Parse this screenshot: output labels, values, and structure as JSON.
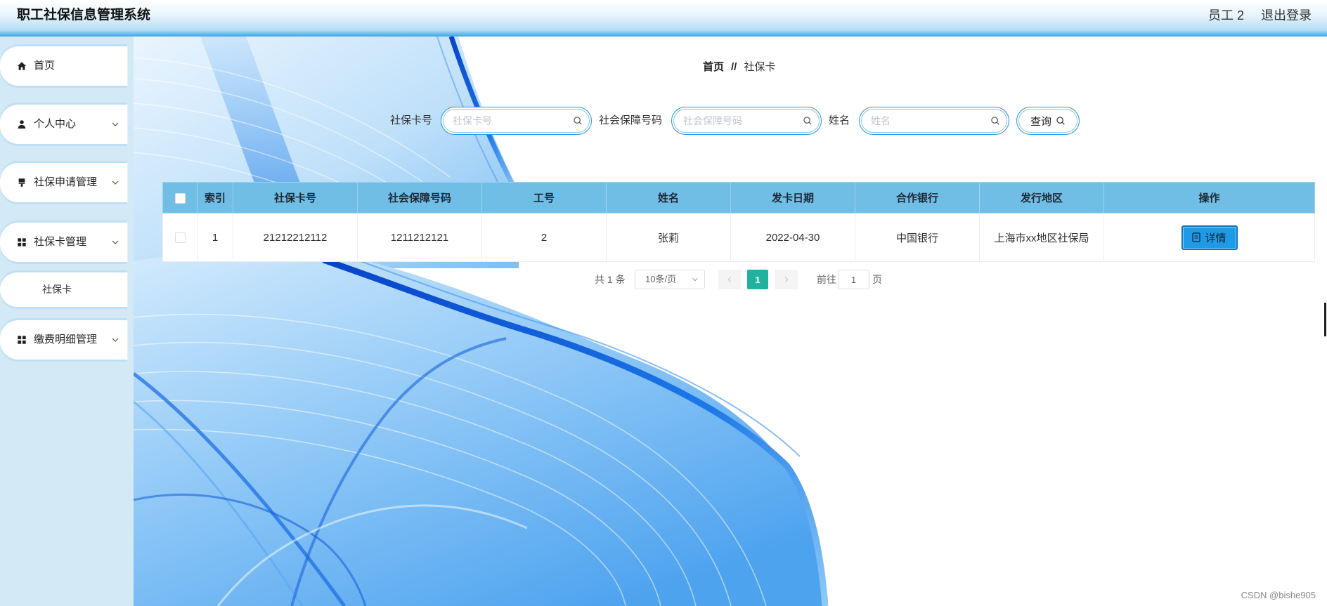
{
  "app": {
    "title": "职工社保信息管理系统"
  },
  "header": {
    "user_label": "员工 2",
    "logout_label": "退出登录"
  },
  "sidebar": {
    "items": [
      {
        "label": "首页",
        "icon": "home-icon"
      },
      {
        "label": "个人中心",
        "icon": "user-icon",
        "has_submenu": true
      },
      {
        "label": "社保申请管理",
        "icon": "stamp-icon",
        "has_submenu": true
      },
      {
        "label": "社保卡管理",
        "icon": "grid-icon",
        "has_submenu": true,
        "expanded": true,
        "children": [
          {
            "label": "社保卡"
          }
        ]
      },
      {
        "label": "缴费明细管理",
        "icon": "grid-icon",
        "has_submenu": true
      }
    ]
  },
  "breadcrumb": {
    "home": "首页",
    "separator": "//",
    "current": "社保卡"
  },
  "search": {
    "fields": [
      {
        "label": "社保卡号",
        "placeholder": "社保卡号",
        "icon": "search-icon"
      },
      {
        "label": "社会保障号码",
        "placeholder": "社会保障号码",
        "icon": "search-icon"
      },
      {
        "label": "姓名",
        "placeholder": "姓名",
        "icon": "search-icon"
      }
    ],
    "button_label": "查询",
    "button_icon": "search-icon"
  },
  "table": {
    "columns": [
      "索引",
      "社保卡号",
      "社会保障号码",
      "工号",
      "姓名",
      "发卡日期",
      "合作银行",
      "发行地区",
      "操作"
    ],
    "rows": [
      {
        "selected": false,
        "index": "1",
        "card_no": "21212212112",
        "social_security_no": "1211212121",
        "employee_no": "2",
        "name": "张莉",
        "issue_date": "2022-04-30",
        "bank": "中国银行",
        "issuing_region": "上海市xx地区社保局",
        "action_label": "详情",
        "action_icon": "document-icon"
      }
    ]
  },
  "pagination": {
    "total_text": "共 1 条",
    "page_size": "10条/页",
    "current_page": "1",
    "goto_label": "前往",
    "goto_value": "1",
    "page_unit": "页"
  },
  "watermark": "CSDN @bishe905",
  "colors": {
    "header_accent": "#3aa4e4",
    "sidebar_bg": "#d3e9f6",
    "table_header_bg": "#70bee6",
    "pager_active": "#20b29f",
    "detail_button": "#1e9be8"
  }
}
